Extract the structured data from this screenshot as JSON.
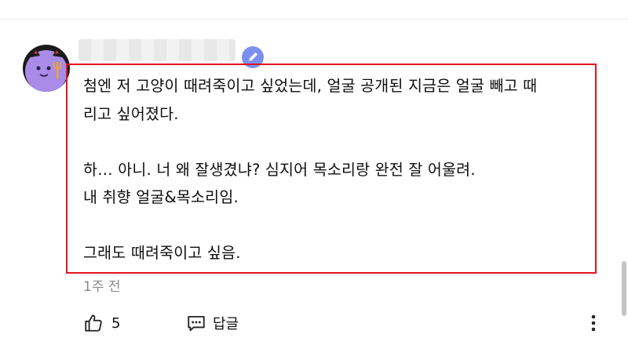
{
  "comment": {
    "lines": [
      "첨엔 저 고양이 때려죽이고 싶었는데, 얼굴 공개된 지금은 얼굴 빼고 때",
      "리고 싶어졌다.",
      "",
      "하… 아니. 너 왜 잘생겼냐? 심지어 목소리랑 완전 잘 어울려.",
      "내 취향 얼굴&목소리임.",
      "",
      "그래도 때려죽이고 싶음."
    ],
    "timestamp": "1주 전",
    "like_count": "5",
    "reply_label": "답글"
  },
  "icons": {
    "avatar": "purple-cat-devil-avatar",
    "badge": "verified-member-badge",
    "like": "thumbs-up-icon",
    "reply": "comment-bubble-icon",
    "more": "vertical-dots-icon"
  },
  "colors": {
    "highlight_border": "#e2141e",
    "avatar_purple": "#a98be8",
    "badge_blue": "#7b8ff0",
    "muted_text": "#8a8a8a"
  }
}
